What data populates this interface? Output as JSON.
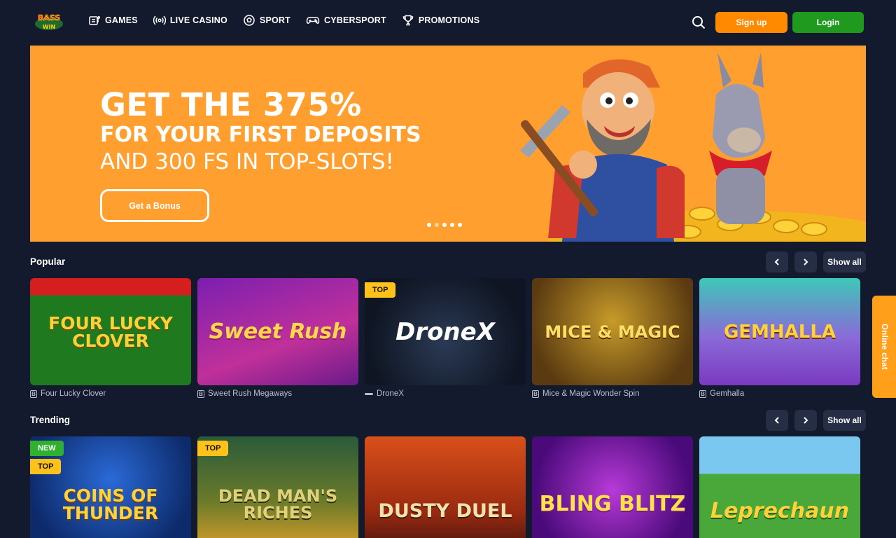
{
  "header": {
    "logo_text_top": "BASS",
    "logo_text_bottom": "WIN",
    "nav": [
      {
        "label": "GAMES",
        "icon": "slot-machine-icon"
      },
      {
        "label": "LIVE CASINO",
        "icon": "broadcast-icon"
      },
      {
        "label": "SPORT",
        "icon": "soccer-ball-icon"
      },
      {
        "label": "CYBERSPORT",
        "icon": "gamepad-icon"
      },
      {
        "label": "PROMOTIONS",
        "icon": "trophy-icon"
      }
    ],
    "signup_label": "Sign up",
    "login_label": "Login"
  },
  "banner": {
    "line1": "GET THE 375%",
    "line2": "FOR YOUR FIRST DEPOSITS",
    "line3": "AND 300 FS IN TOP-SLOTS!",
    "cta_label": "Get a Bonus",
    "slides": 5,
    "active_slide": 1
  },
  "popular": {
    "title": "Popular",
    "show_all": "Show all",
    "games": [
      {
        "name": "Four Lucky Clover",
        "art": "FOUR LUCKY CLOVER",
        "provider": "B"
      },
      {
        "name": "Sweet Rush Megaways",
        "art": "Sweet Rush",
        "provider": "B"
      },
      {
        "name": "DroneX",
        "art": "DroneX",
        "provider": "",
        "badge": "TOP"
      },
      {
        "name": "Mice & Magic Wonder Spin",
        "art": "MICE & MAGIC",
        "provider": "B"
      },
      {
        "name": "Gemhalla",
        "art": "GEMHALLA",
        "provider": "B"
      }
    ]
  },
  "trending": {
    "title": "Trending",
    "show_all": "Show all",
    "games": [
      {
        "art": "COINS OF THUNDER",
        "badges": [
          "NEW",
          "TOP"
        ]
      },
      {
        "art": "DEAD MAN'S RICHES",
        "badges": [
          "TOP"
        ]
      },
      {
        "art": "DUSTY DUEL",
        "badges": []
      },
      {
        "art": "BLING BLITZ",
        "badges": []
      },
      {
        "art": "Leprechaun",
        "badges": []
      }
    ]
  },
  "chat": {
    "label": "Online chat"
  },
  "colors": {
    "bg": "#131a2e",
    "banner": "#ff9f30",
    "signup": "#ff8a00",
    "login": "#1f9a1f",
    "badge_top": "#ffc21a",
    "badge_new": "#2fb12f"
  }
}
